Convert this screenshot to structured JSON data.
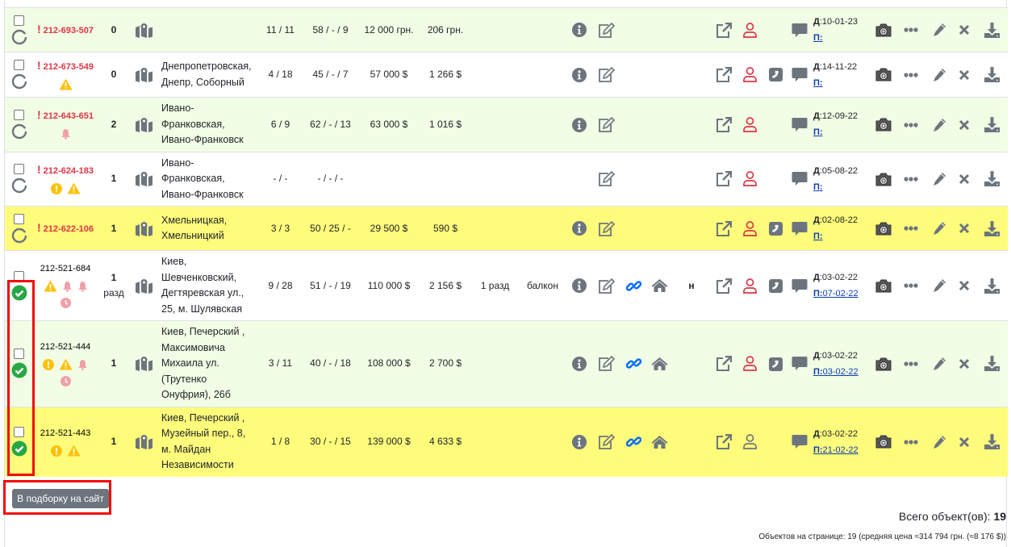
{
  "colors": {
    "accent_red": "#dc3545",
    "warning": "#ffc107",
    "bell": "#f0a0a8",
    "green": "#28a745",
    "icon_gray": "#6c757d",
    "link_blue": "#0d6efd"
  },
  "rows": [
    {
      "id": "212-693-507",
      "urgent": true,
      "badges": [],
      "rooms": "0",
      "rooms_sub": "",
      "address": "",
      "floors": "11 / 11",
      "area": "58 / - / 9",
      "price": "12 000 грн.",
      "ppm": "206 грн.",
      "extra1": "",
      "extra2": "",
      "info": true,
      "link": false,
      "home": false,
      "flag": "",
      "user_red": true,
      "phone": false,
      "date_d": "10-01-23",
      "date_p": "",
      "bg": "g",
      "status": "spinner"
    },
    {
      "id": "212-673-549",
      "urgent": true,
      "badges": [
        "warning"
      ],
      "rooms": "0",
      "rooms_sub": "",
      "address": "Днепропетровская, Днепр, Соборный",
      "floors": "4 / 18",
      "area": "45 / - / 7",
      "price": "57 000 $",
      "ppm": "1 266 $",
      "extra1": "",
      "extra2": "",
      "info": true,
      "link": false,
      "home": false,
      "flag": "",
      "user_red": true,
      "phone": true,
      "date_d": "14-11-22",
      "date_p": "",
      "bg": "w",
      "status": "spinner"
    },
    {
      "id": "212-643-651",
      "urgent": true,
      "badges": [
        "bell"
      ],
      "rooms": "2",
      "rooms_sub": "",
      "address": "Ивано-Франковская, Ивано-Франковск",
      "floors": "6 / 9",
      "area": "62 / - / 13",
      "price": "63 000 $",
      "ppm": "1 016 $",
      "extra1": "",
      "extra2": "",
      "info": true,
      "link": false,
      "home": false,
      "flag": "",
      "user_red": true,
      "phone": false,
      "date_d": "12-09-22",
      "date_p": "",
      "bg": "g",
      "status": "spinner"
    },
    {
      "id": "212-624-183",
      "urgent": true,
      "badges": [
        "exclaim",
        "warning"
      ],
      "rooms": "1",
      "rooms_sub": "",
      "address": "Ивано-Франковская, Ивано-Франковск",
      "floors": "- / -",
      "area": "- / - / -",
      "price": "",
      "ppm": "",
      "extra1": "",
      "extra2": "",
      "info": false,
      "link": false,
      "home": false,
      "flag": "",
      "user_red": true,
      "phone": false,
      "date_d": "05-08-22",
      "date_p": "",
      "bg": "w",
      "status": "spinner"
    },
    {
      "id": "212-622-106",
      "urgent": true,
      "badges": [],
      "rooms": "1",
      "rooms_sub": "",
      "address": "Хмельницкая, Хмельницкий",
      "floors": "3 / 3",
      "area": "50 / 25 / -",
      "price": "29 500 $",
      "ppm": "590 $",
      "extra1": "",
      "extra2": "",
      "info": true,
      "link": false,
      "home": false,
      "flag": "",
      "user_red": true,
      "phone": true,
      "date_d": "02-08-22",
      "date_p": "",
      "bg": "y",
      "status": "spinner"
    },
    {
      "id": "212-521-684",
      "urgent": false,
      "badges": [
        "warning",
        "bell",
        "bell",
        "clock"
      ],
      "rooms": "1",
      "rooms_sub": "разд",
      "address": "Киев, Шевченковский, Дегтяревская ул., 25, м. Шулявская",
      "floors": "9 / 28",
      "area": "51 / - / 19",
      "price": "110 000 $",
      "ppm": "2 156 $",
      "extra1": "1 разд",
      "extra2": "балкон",
      "info": true,
      "link": true,
      "home": true,
      "flag": "н",
      "user_red": true,
      "phone": true,
      "date_d": "03-02-22",
      "date_p": "07-02-22",
      "bg": "w",
      "status": "check"
    },
    {
      "id": "212-521-444",
      "urgent": false,
      "badges": [
        "exclaim",
        "warning",
        "bell",
        "clock"
      ],
      "rooms": "1",
      "rooms_sub": "",
      "address": "Киев, Печерский , Максимовича Михаила ул. (Трутенко Онуфрия), 26б",
      "floors": "3 / 11",
      "area": "40 / - / 18",
      "price": "108 000 $",
      "ppm": "2 700 $",
      "extra1": "",
      "extra2": "",
      "info": true,
      "link": true,
      "home": true,
      "flag": "",
      "user_red": true,
      "phone": true,
      "date_d": "03-02-22",
      "date_p": "03-02-22",
      "bg": "g",
      "status": "check"
    },
    {
      "id": "212-521-443",
      "urgent": false,
      "badges": [
        "exclaim",
        "warning"
      ],
      "rooms": "1",
      "rooms_sub": "",
      "address": "Киев, Печерский , Музейный пер., 8, м. Майдан Независимости",
      "floors": "1 / 8",
      "area": "30 / - / 15",
      "price": "139 000 $",
      "ppm": "4 633 $",
      "extra1": "",
      "extra2": "",
      "info": true,
      "link": true,
      "home": true,
      "flag": "",
      "user_red": false,
      "phone": false,
      "date_d": "03-02-22",
      "date_p": "21-02-22",
      "bg": "y",
      "status": "check"
    }
  ],
  "labels": {
    "date_d_prefix": "Д",
    "date_p_prefix": "П",
    "urgent_mark": "!"
  },
  "footer": {
    "button": "В подборку на сайт",
    "total_label": "Всего объект(ов): ",
    "total_value": "19",
    "per_page": "Объектов на странице: 19 (средняя цена ≈314 794 грн. (≈8 176 $))"
  }
}
